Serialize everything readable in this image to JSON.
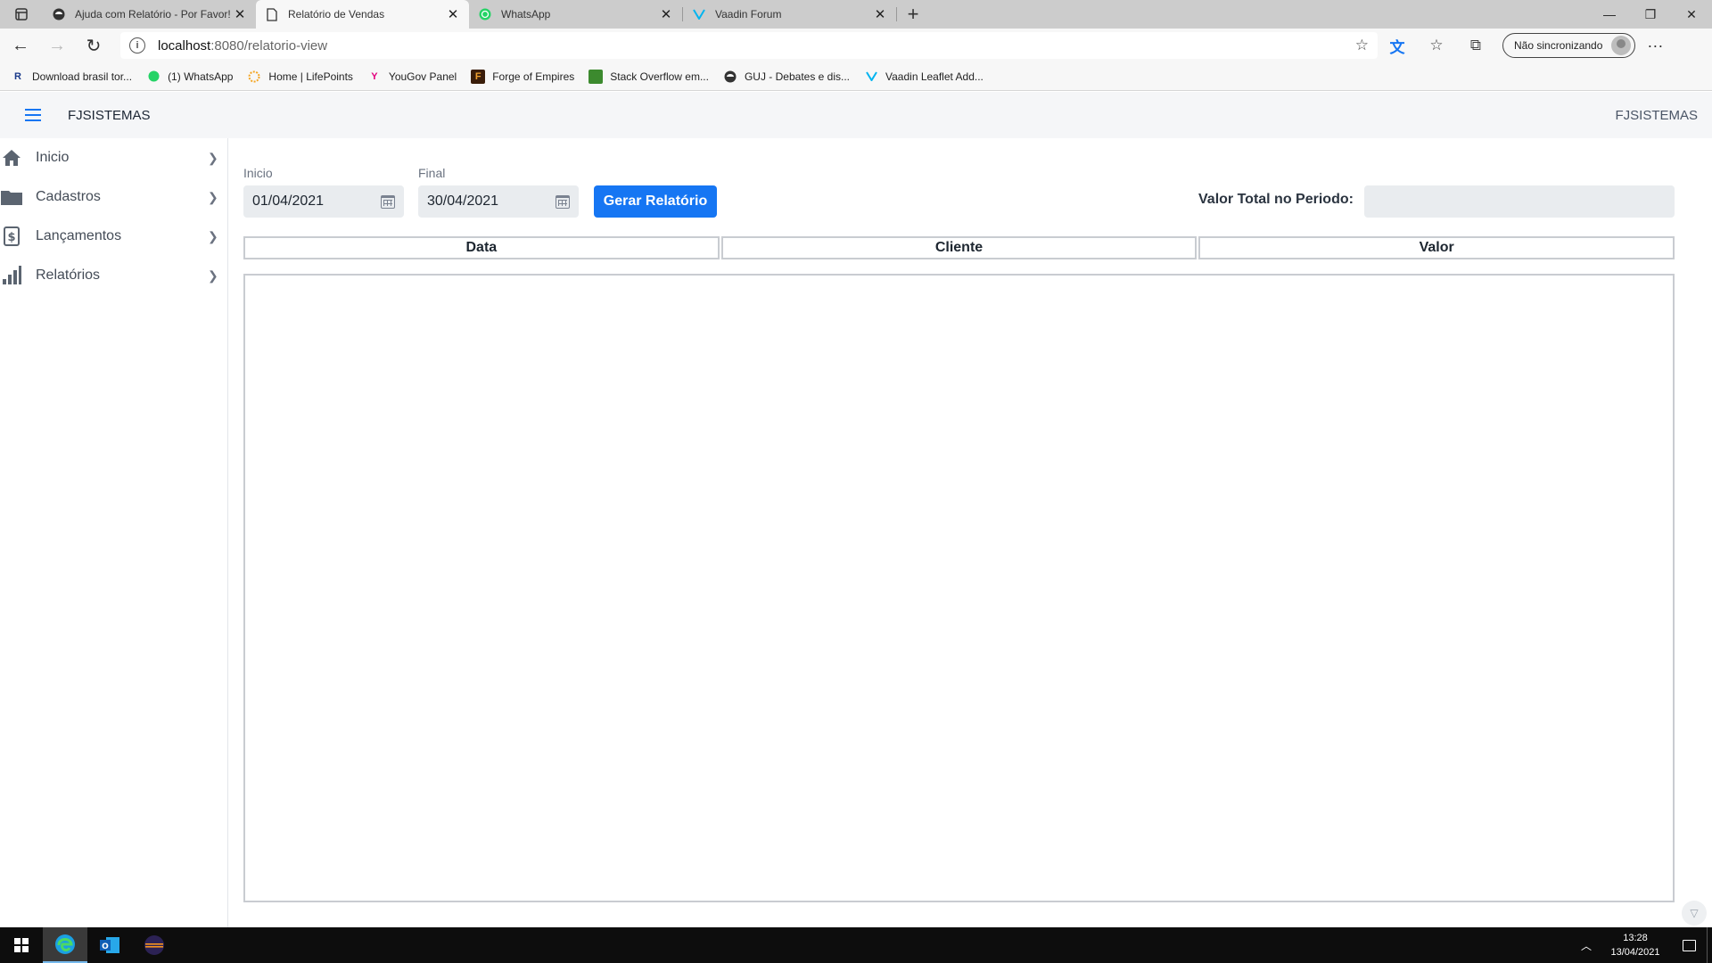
{
  "browser": {
    "tabs": [
      {
        "title": "Ajuda com Relatório - Por Favor!",
        "icon": "forum-icon",
        "active": false
      },
      {
        "title": "Relatório de Vendas",
        "icon": "page-icon",
        "active": true
      },
      {
        "title": "WhatsApp",
        "icon": "whatsapp-icon",
        "active": false
      },
      {
        "title": "Vaadin Forum",
        "icon": "vaadin-icon",
        "active": false
      }
    ],
    "url_host": "localhost",
    "url_path": ":8080/relatorio-view",
    "sync_label": "Não sincronizando",
    "bookmarks": [
      {
        "label": "Download brasil tor...",
        "icon": "R"
      },
      {
        "label": "(1) WhatsApp",
        "icon": "whatsapp"
      },
      {
        "label": "Home | LifePoints",
        "icon": "lifepoints"
      },
      {
        "label": "YouGov Panel",
        "icon": "yougov"
      },
      {
        "label": "Forge of Empires",
        "icon": "F"
      },
      {
        "label": "Stack Overflow em...",
        "icon": "so"
      },
      {
        "label": "GUJ - Debates e dis...",
        "icon": "guj"
      },
      {
        "label": "Vaadin Leaflet Add...",
        "icon": "vaadin"
      }
    ]
  },
  "header": {
    "title": "FJSISTEMAS",
    "title_right": "FJSISTEMAS"
  },
  "sidebar": {
    "items": [
      {
        "label": "Inicio",
        "icon": "home-icon"
      },
      {
        "label": "Cadastros",
        "icon": "folder-icon"
      },
      {
        "label": "Lançamentos",
        "icon": "ledger-icon"
      },
      {
        "label": "Relatórios",
        "icon": "bar-chart-icon"
      }
    ]
  },
  "form": {
    "start_label": "Inicio",
    "start_value": "01/04/2021",
    "end_label": "Final",
    "end_value": "30/04/2021",
    "generate_button": "Gerar Relatório",
    "total_label": "Valor Total no Periodo:",
    "total_value": ""
  },
  "table": {
    "columns": [
      "Data",
      "Cliente",
      "Valor"
    ],
    "rows": []
  },
  "taskbar": {
    "time": "13:28",
    "date": "13/04/2021"
  },
  "colors": {
    "accent": "#1676f3",
    "field_bg": "#e9ecef"
  }
}
